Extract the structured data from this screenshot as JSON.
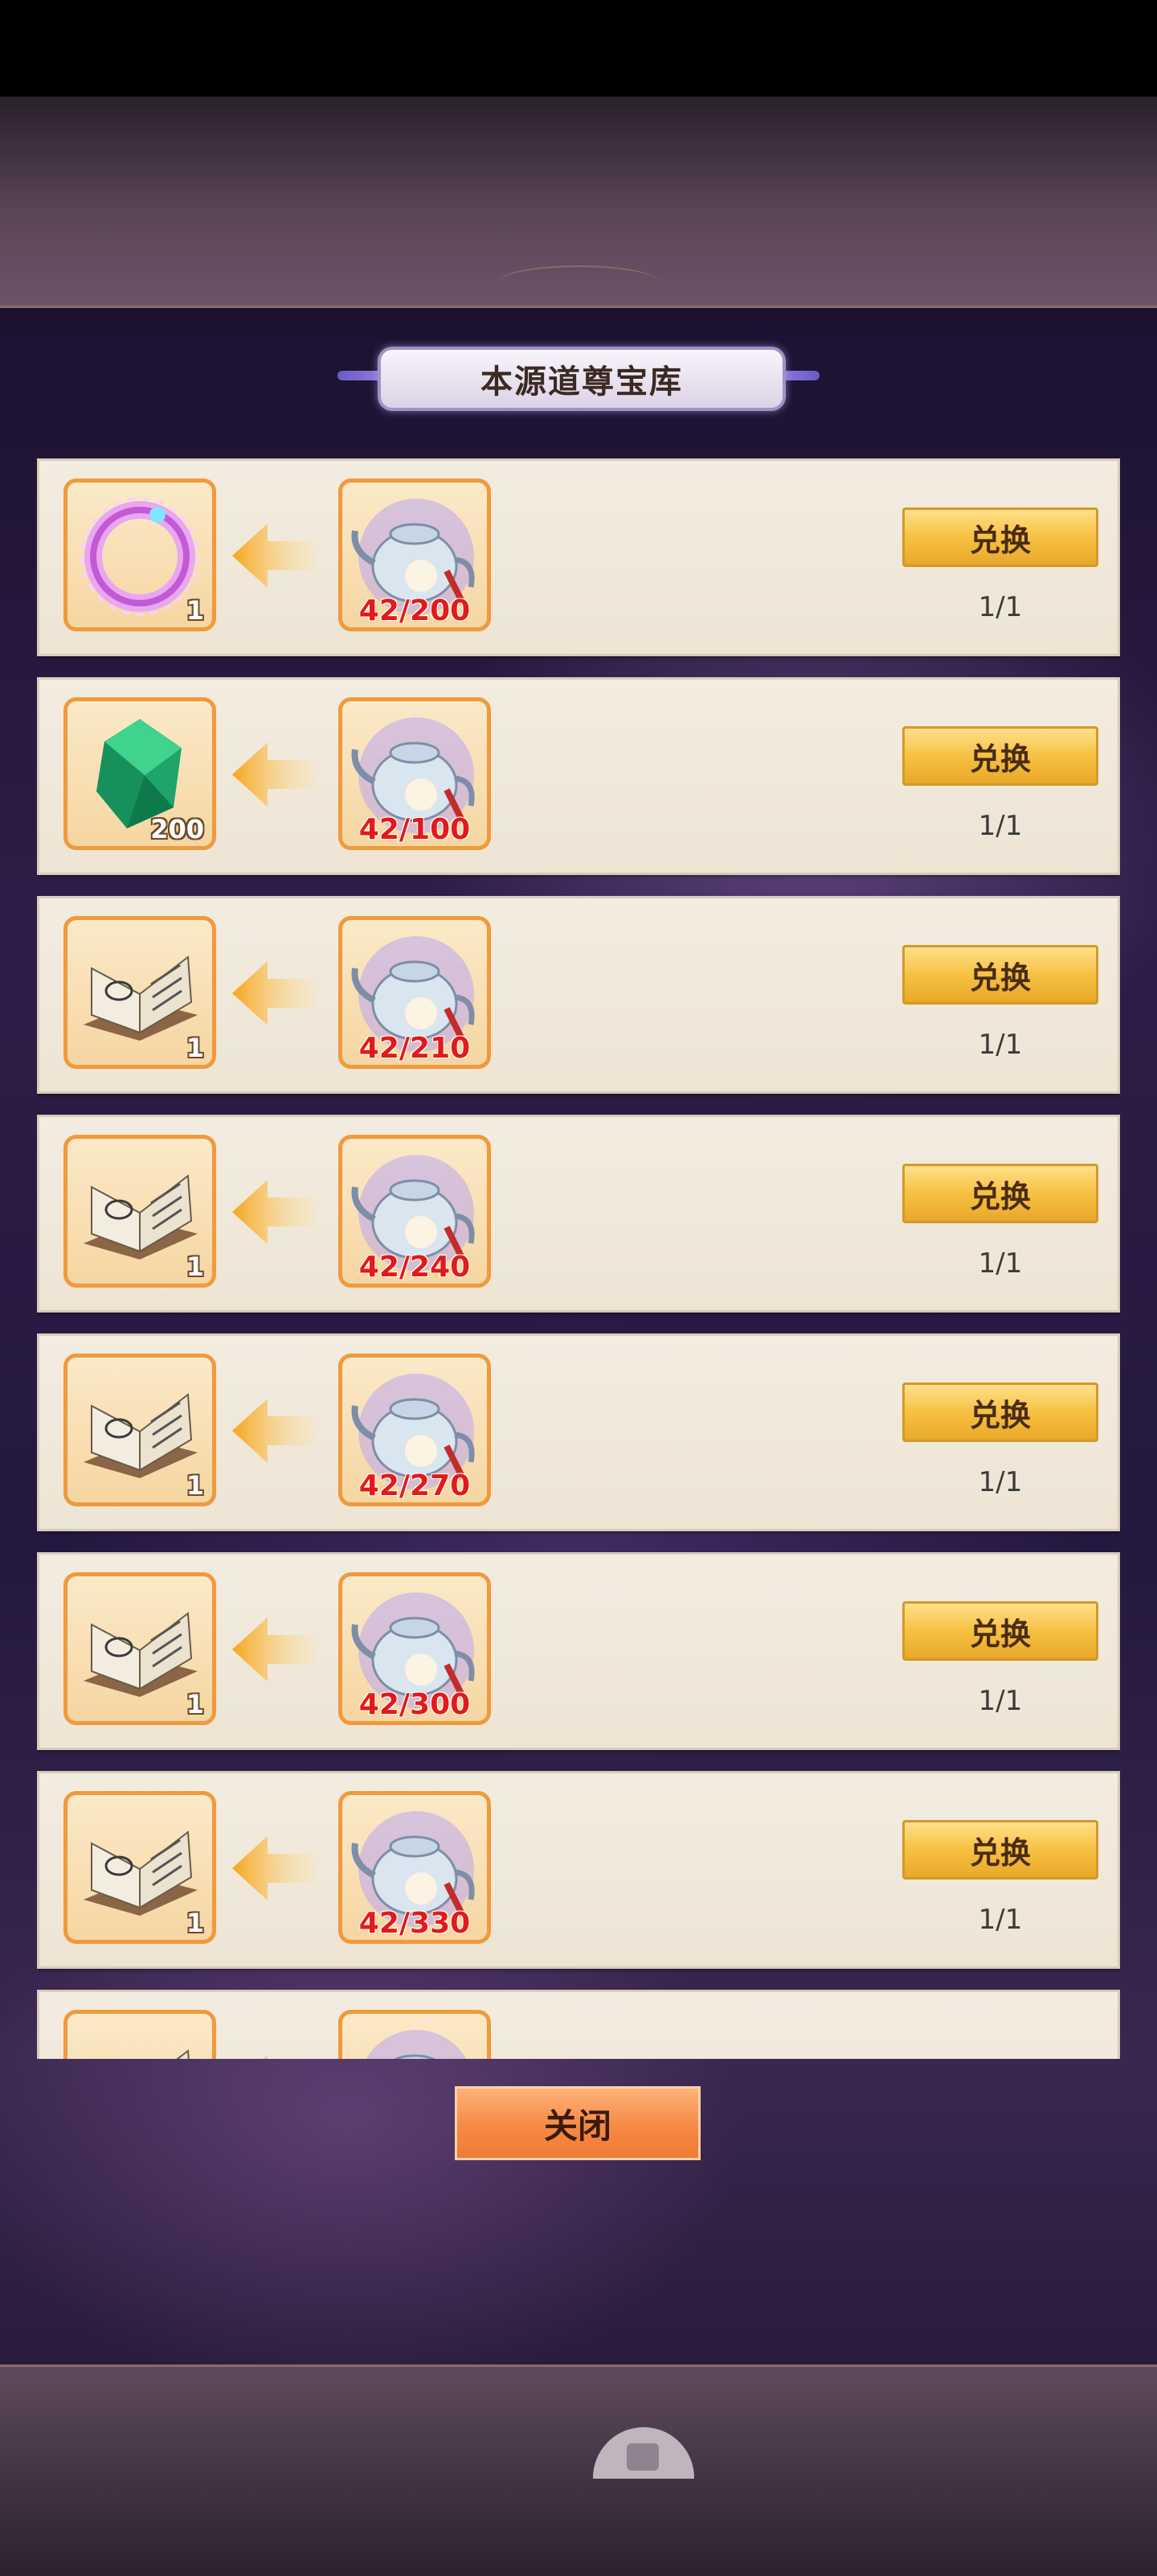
{
  "title": "本源道尊宝库",
  "exchange_label": "兑换",
  "close_label": "关闭",
  "rows": [
    {
      "reward": "ring-icon",
      "reward_qty": "1",
      "cost_icon": "teapot-icon",
      "cost_count": "42/200",
      "limit": "1/1"
    },
    {
      "reward": "emerald-gem-icon",
      "reward_qty": "200",
      "cost_icon": "teapot-icon",
      "cost_count": "42/100",
      "limit": "1/1"
    },
    {
      "reward": "skill-book-icon",
      "reward_qty": "1",
      "cost_icon": "teapot-icon",
      "cost_count": "42/210",
      "limit": "1/1"
    },
    {
      "reward": "skill-book-icon",
      "reward_qty": "1",
      "cost_icon": "teapot-icon",
      "cost_count": "42/240",
      "limit": "1/1"
    },
    {
      "reward": "skill-book-icon",
      "reward_qty": "1",
      "cost_icon": "teapot-icon",
      "cost_count": "42/270",
      "limit": "1/1"
    },
    {
      "reward": "skill-book-icon",
      "reward_qty": "1",
      "cost_icon": "teapot-icon",
      "cost_count": "42/300",
      "limit": "1/1"
    },
    {
      "reward": "skill-book-icon",
      "reward_qty": "1",
      "cost_icon": "teapot-icon",
      "cost_count": "42/330",
      "limit": "1/1"
    },
    {
      "reward": "skill-book-icon",
      "reward_qty": "",
      "cost_icon": "teapot-icon",
      "cost_count": "",
      "limit": ""
    }
  ]
}
